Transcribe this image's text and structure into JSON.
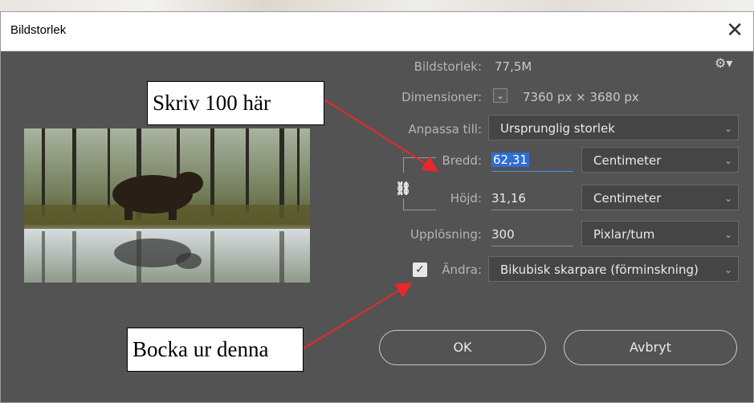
{
  "dialog": {
    "title": "Bildstorlek",
    "close_glyph": "✕"
  },
  "info": {
    "image_size_label": "Bildstorlek:",
    "image_size_value": "77,5M",
    "settings_icon": "gear-icon",
    "dimensions_label": "Dimensioner:",
    "dimensions_value": "7360 px  ×  3680 px"
  },
  "fit": {
    "label": "Anpassa till:",
    "value": "Ursprunglig storlek"
  },
  "width": {
    "label": "Bredd:",
    "value": "62,31",
    "unit": "Centimeter"
  },
  "height": {
    "label": "Höjd:",
    "value": "31,16",
    "unit": "Centimeter"
  },
  "resolution": {
    "label": "Upplösning:",
    "value": "300",
    "unit": "Pixlar/tum"
  },
  "resample": {
    "checked": true,
    "label": "Ändra:",
    "value": "Bikubisk skarpare (förminskning)"
  },
  "buttons": {
    "ok": "OK",
    "cancel": "Avbryt"
  },
  "annotations": {
    "top": "Skriv 100 här",
    "bottom": "Bocka ur denna",
    "arrow_color": "#e8282b"
  },
  "colors": {
    "dialog_bg": "#535353",
    "selection": "#2f6ed3"
  }
}
